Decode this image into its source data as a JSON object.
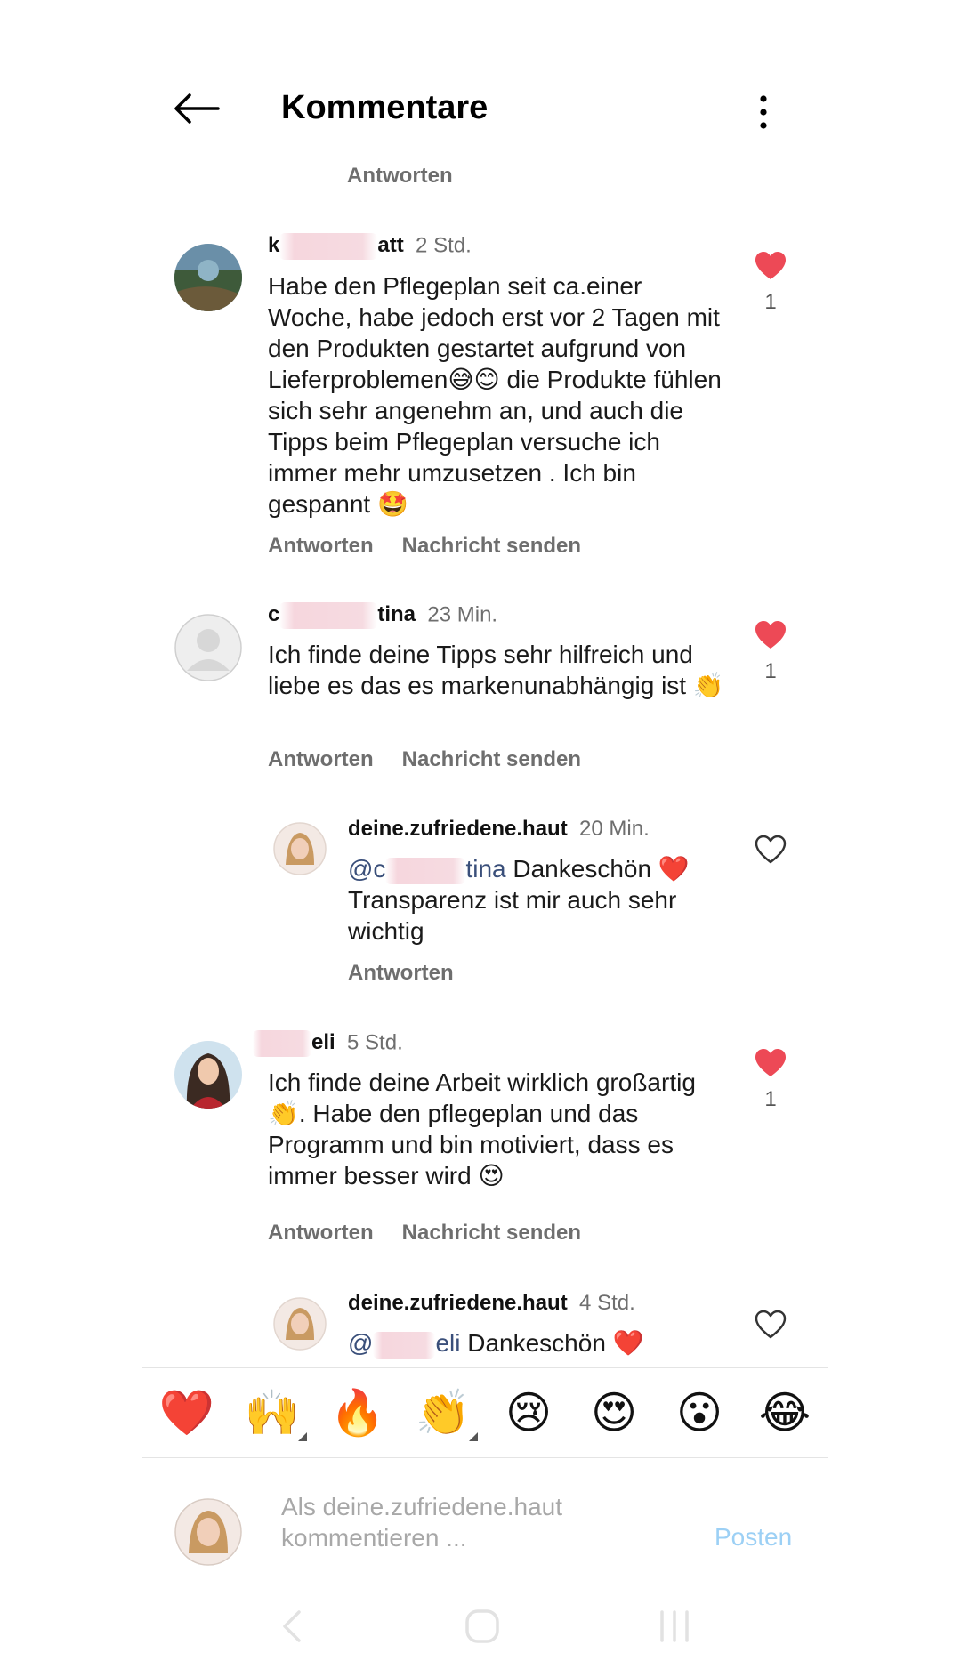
{
  "header": {
    "title": "Kommentare"
  },
  "top_reply_label": "Antworten",
  "comments": [
    {
      "username_suffix": "att",
      "username_prefix": "k",
      "time": "2 Std.",
      "text": "Habe den Pflegeplan seit ca.einer Woche, habe jedoch erst vor 2 Tagen mit den Produkten gestartet aufgrund von Lieferproblemen😅😊 die Produkte fühlen sich sehr angenehm an, und auch die Tipps beim Pflegeplan versuche ich immer mehr umzusetzen . Ich bin gespannt 🤩",
      "reply_label": "Antworten",
      "message_label": "Nachricht senden",
      "likes": "1",
      "liked": true
    },
    {
      "username_prefix": "c",
      "username_suffix": "tina",
      "time": "23 Min.",
      "text": "Ich finde deine Tipps sehr hilfreich und liebe es das es markenunabhängig ist 👏",
      "reply_label": "Antworten",
      "message_label": "Nachricht senden",
      "likes": "1",
      "liked": true
    },
    {
      "username": "deine.zufriedene.haut",
      "time": "20 Min.",
      "mention_prefix": "@c",
      "mention_suffix": "tina",
      "text": "Dankeschön ❤️ Transparenz ist mir auch sehr wichtig",
      "reply_label": "Antworten",
      "liked": false
    },
    {
      "username_suffix": "eli",
      "time": "5 Std.",
      "text": "Ich finde deine Arbeit wirklich großartig 👏. Habe den pflegeplan und das Programm und bin motiviert, dass es immer besser wird 😍",
      "reply_label": "Antworten",
      "message_label": "Nachricht senden",
      "likes": "1",
      "liked": true
    },
    {
      "username": "deine.zufriedene.haut",
      "time": "4 Std.",
      "mention_prefix": "@",
      "mention_suffix": "eli",
      "text": "Dankeschön ❤️",
      "liked": false
    }
  ],
  "emoji_bar": [
    "❤️",
    "🙌",
    "🔥",
    "👏",
    "😢",
    "😍",
    "😮",
    "😂"
  ],
  "composer": {
    "placeholder": "Als deine.zufriedene.haut kommentieren ...",
    "post_label": "Posten"
  },
  "colors": {
    "like_red": "#ed4956",
    "muted_text": "#6e6e6e",
    "post_blue_disabled": "#9cd0f5",
    "mention_blue": "#3a4f7a"
  },
  "icons": [
    "back-arrow-icon",
    "more-vertical-icon",
    "heart-filled-icon",
    "heart-outline-icon",
    "nav-back-icon",
    "nav-home-icon",
    "nav-recents-icon"
  ]
}
